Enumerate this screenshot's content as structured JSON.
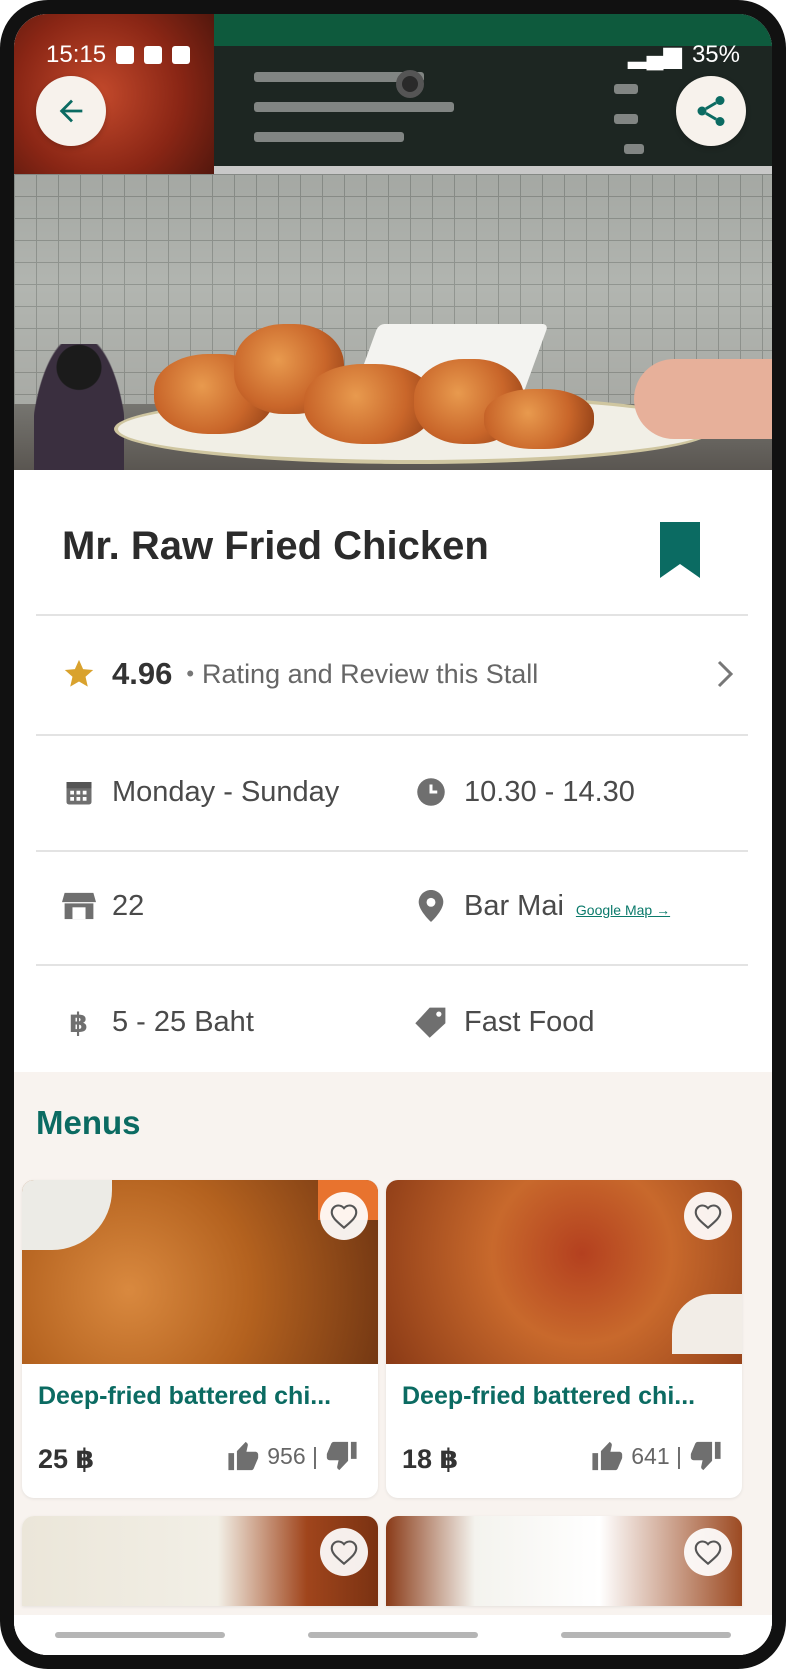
{
  "status_bar": {
    "time": "15:15",
    "battery": "35%"
  },
  "hero": {
    "back_label": "Back",
    "share_label": "Share"
  },
  "stall": {
    "name": "Mr. Raw Fried Chicken",
    "rating": "4.96",
    "rating_separator": "•",
    "rating_text": "Rating and Review this Stall",
    "days": "Monday - Sunday",
    "hours": "10.30 - 14.30",
    "stall_number": "22",
    "location": "Bar Mai",
    "map_link": "Google Map →",
    "price_range": "5 - 25 Baht",
    "category": "Fast Food"
  },
  "colors": {
    "accent": "#0b6b62",
    "star": "#d9a22d",
    "menus_bg": "#f8f3ef"
  },
  "icons": {
    "back": "arrow-left-icon",
    "share": "share-icon",
    "bookmark": "bookmark-icon",
    "star": "star-icon",
    "calendar": "calendar-icon",
    "clock": "clock-icon",
    "store": "storefront-icon",
    "pin": "location-pin-icon",
    "baht": "baht-icon",
    "tag": "tag-icon",
    "heart": "heart-icon",
    "thumb_up": "thumbs-up-icon",
    "thumb_down": "thumbs-down-icon",
    "chevron": "chevron-right-icon"
  },
  "menus": {
    "title": "Menus",
    "items": [
      {
        "name": "Deep-fried battered chi...",
        "price": "25 ฿",
        "likes": "956 |"
      },
      {
        "name": "Deep-fried battered chi...",
        "price": "18 ฿",
        "likes": "641 |"
      }
    ]
  }
}
